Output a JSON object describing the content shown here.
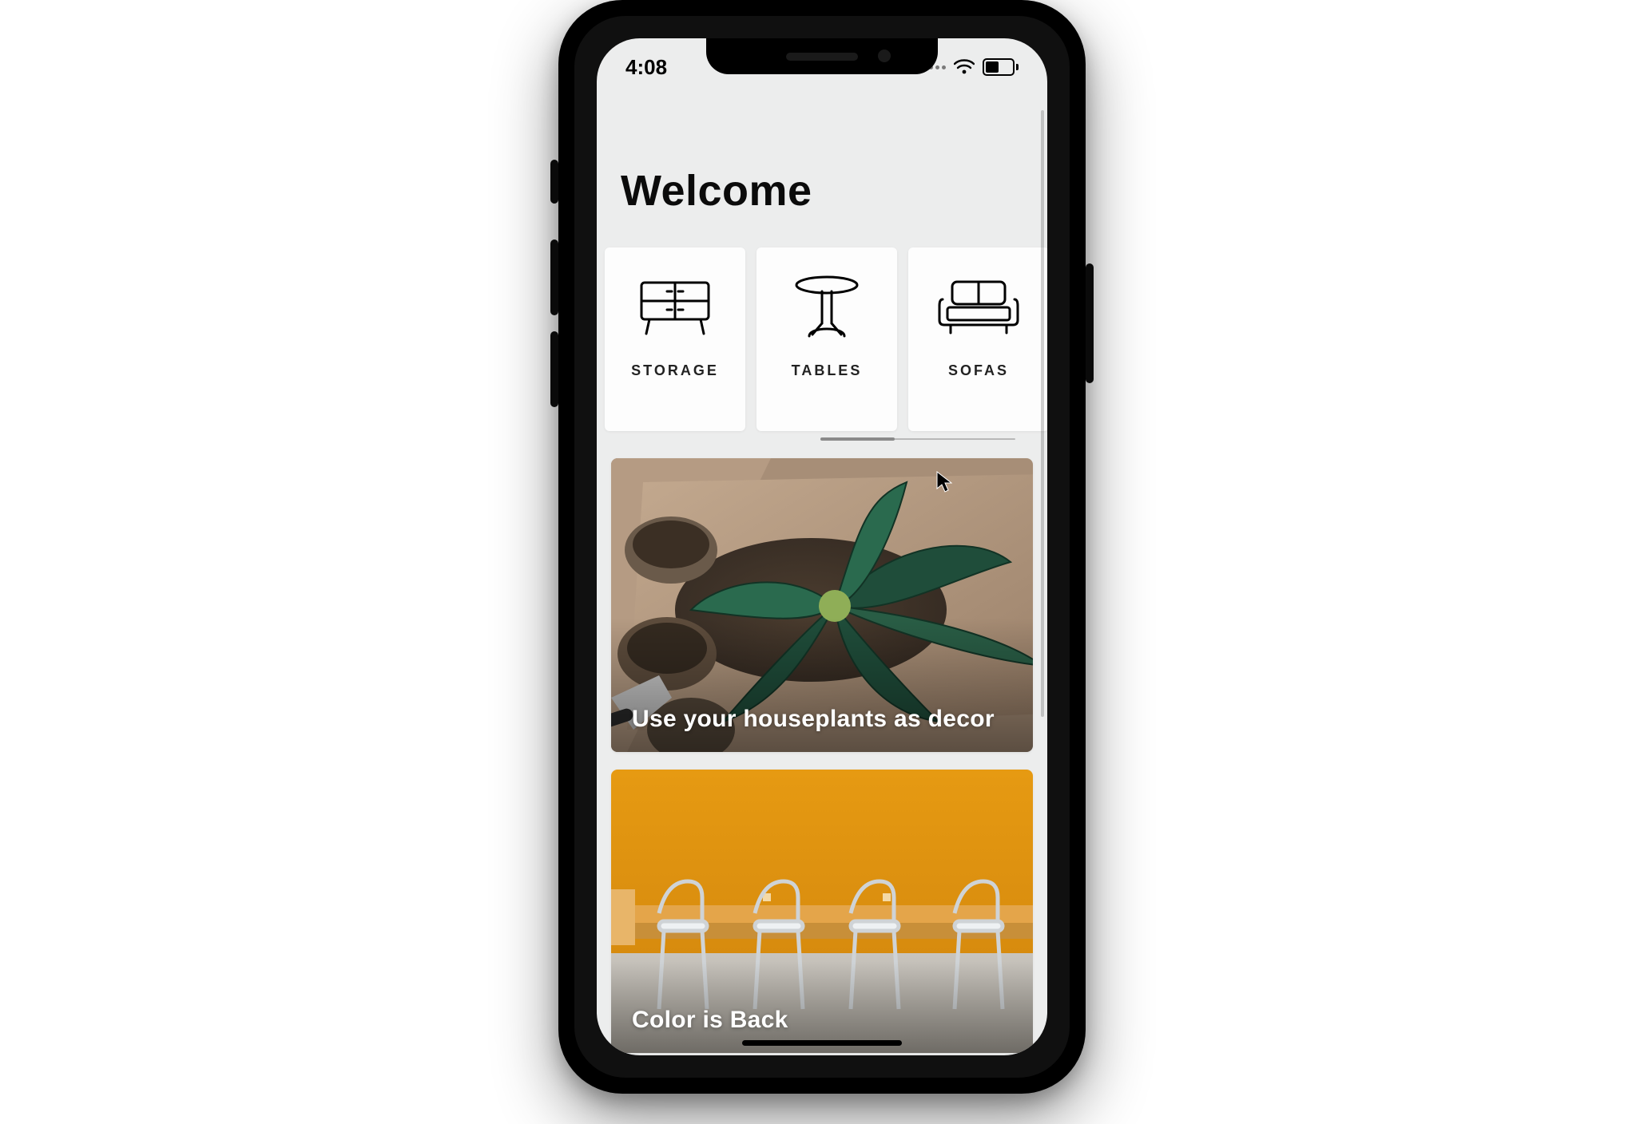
{
  "status": {
    "time": "4:08"
  },
  "header": {
    "title": "Welcome"
  },
  "categories": [
    {
      "id": "storage",
      "label": "STORAGE",
      "icon": "storage-icon"
    },
    {
      "id": "tables",
      "label": "TABLES",
      "icon": "table-icon"
    },
    {
      "id": "sofas",
      "label": "SOFAS",
      "icon": "sofa-icon"
    }
  ],
  "articles": [
    {
      "id": "houseplants",
      "title": "Use your houseplants as decor"
    },
    {
      "id": "color-back",
      "title": "Color is Back"
    }
  ]
}
